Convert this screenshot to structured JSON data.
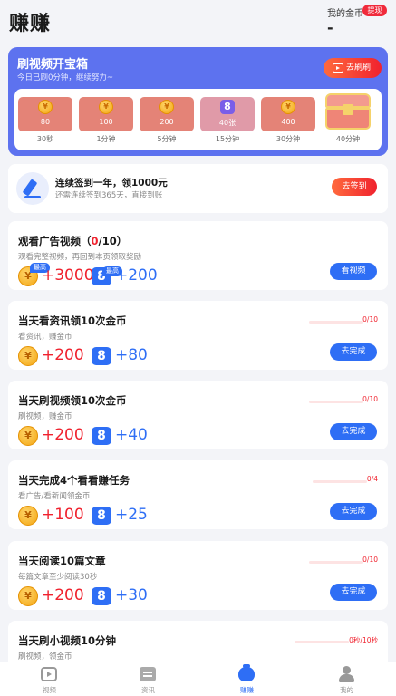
{
  "header": {
    "title": "赚赚",
    "coins_label": "我的金币",
    "withdraw_label": "提现",
    "coins_value": "-"
  },
  "chest": {
    "title": "刷视频开宝箱",
    "subtitle": "今日已刷0分钟，继续努力~",
    "button_label": "去刷刷",
    "tiers": [
      {
        "value": "80",
        "time": "30秒",
        "kind": "coin"
      },
      {
        "value": "100",
        "time": "1分钟",
        "kind": "coin"
      },
      {
        "value": "200",
        "time": "5分钟",
        "kind": "coin"
      },
      {
        "value": "40张",
        "time": "15分钟",
        "kind": "ticket"
      },
      {
        "value": "400",
        "time": "30分钟",
        "kind": "coin"
      },
      {
        "value": "",
        "time": "40分钟",
        "kind": "chest"
      }
    ]
  },
  "signin": {
    "title": "连续签到一年，领1000元",
    "subtitle": "还需连续签到365天，直接到账",
    "button_label": "去签到"
  },
  "tasks": [
    {
      "title_prefix": "观看广告视频（",
      "title_highlight": "0",
      "title_suffix": "/10）",
      "subtitle": "观看完整视频，再回到本页领取奖励",
      "coin_reward": "+3000",
      "ticket_reward": "+200",
      "coin_badge": "最高",
      "ticket_badge": "最高",
      "button_label": "看视频"
    },
    {
      "title": "当天看资讯领10次金币",
      "subtitle": "看资讯，赚金币",
      "coin_reward": "+200",
      "ticket_reward": "+80",
      "progress": "0/10",
      "progress_fraction": 0,
      "button_label": "去完成"
    },
    {
      "title": "当天刷视频领10次金币",
      "subtitle": "刷视频，赚金币",
      "coin_reward": "+200",
      "ticket_reward": "+40",
      "progress": "0/10",
      "progress_fraction": 0,
      "button_label": "去完成"
    },
    {
      "title": "当天完成4个看看赚任务",
      "subtitle": "看广告/看新闻领金币",
      "coin_reward": "+100",
      "ticket_reward": "+25",
      "progress": "0/4",
      "progress_fraction": 0,
      "button_label": "去完成"
    },
    {
      "title": "当天阅读10篇文章",
      "subtitle": "每篇文章至少阅读30秒",
      "coin_reward": "+200",
      "ticket_reward": "+30",
      "progress": "0/10",
      "progress_fraction": 0,
      "button_label": "去完成"
    },
    {
      "title": "当天刷小视频10分钟",
      "subtitle": "刷视频，领金币",
      "progress": "0秒/10秒",
      "progress_fraction": 0
    }
  ],
  "tabbar": [
    {
      "label": "视频",
      "icon": "video-icon",
      "active": false
    },
    {
      "label": "资讯",
      "icon": "news-icon",
      "active": false
    },
    {
      "label": "赚赚",
      "icon": "money-bag-icon",
      "active": true
    },
    {
      "label": "我的",
      "icon": "profile-icon",
      "active": false
    }
  ],
  "colors": {
    "primary": "#2e6ef5",
    "accent_red": "#f0222e",
    "chest_bg": "#5d72ef",
    "coin": "#f3a512"
  }
}
